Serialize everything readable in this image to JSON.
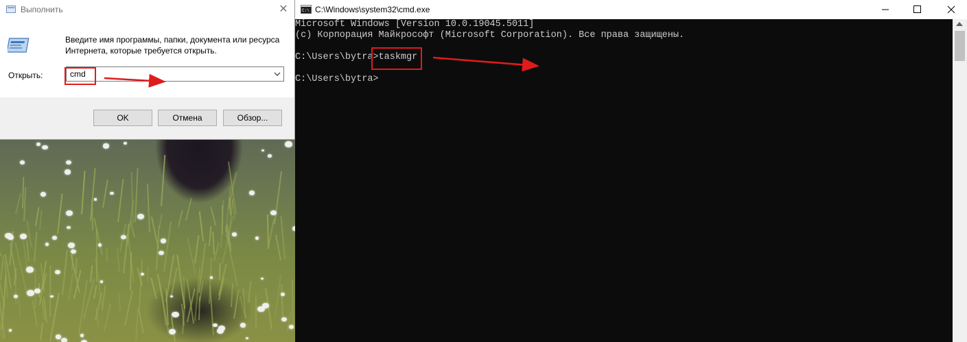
{
  "run_dialog": {
    "title": "Выполнить",
    "description": "Введите имя программы, папки, документа или ресурса Интернета, которые требуется открыть.",
    "open_label": "Открыть:",
    "input_value": "cmd",
    "buttons": {
      "ok": "OK",
      "cancel": "Отмена",
      "browse": "Обзор..."
    }
  },
  "cmd_window": {
    "title": "C:\\Windows\\system32\\cmd.exe",
    "lines": [
      "Microsoft Windows [Version 10.0.19045.5011]",
      "(c) Корпорация Майкрософт (Microsoft Corporation). Все права защищены.",
      "",
      "C:\\Users\\bytra>taskmgr",
      "",
      "C:\\Users\\bytra>"
    ]
  },
  "colors": {
    "annotation": "#e01b1b",
    "console_bg": "#0c0c0c",
    "console_text": "#cccccc"
  }
}
